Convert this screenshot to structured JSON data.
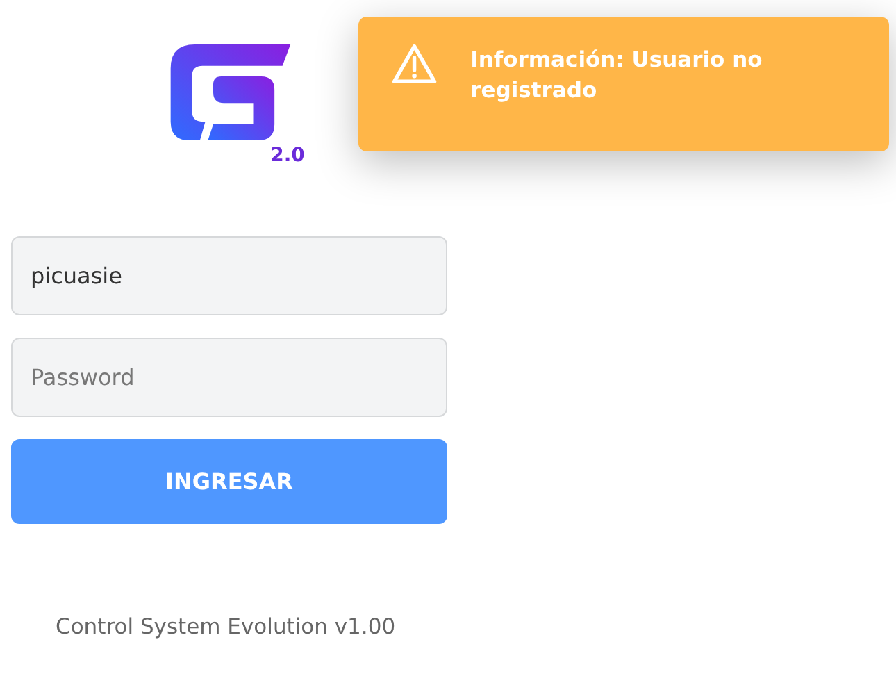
{
  "logo": {
    "version": "2.0"
  },
  "form": {
    "username": {
      "value": "picuasie"
    },
    "password": {
      "placeholder": "Password"
    },
    "submit": "INGRESAR"
  },
  "footer": "Control System Evolution v1.00",
  "toast": {
    "kind": "warning",
    "message": "Información: Usuario no registrado"
  }
}
